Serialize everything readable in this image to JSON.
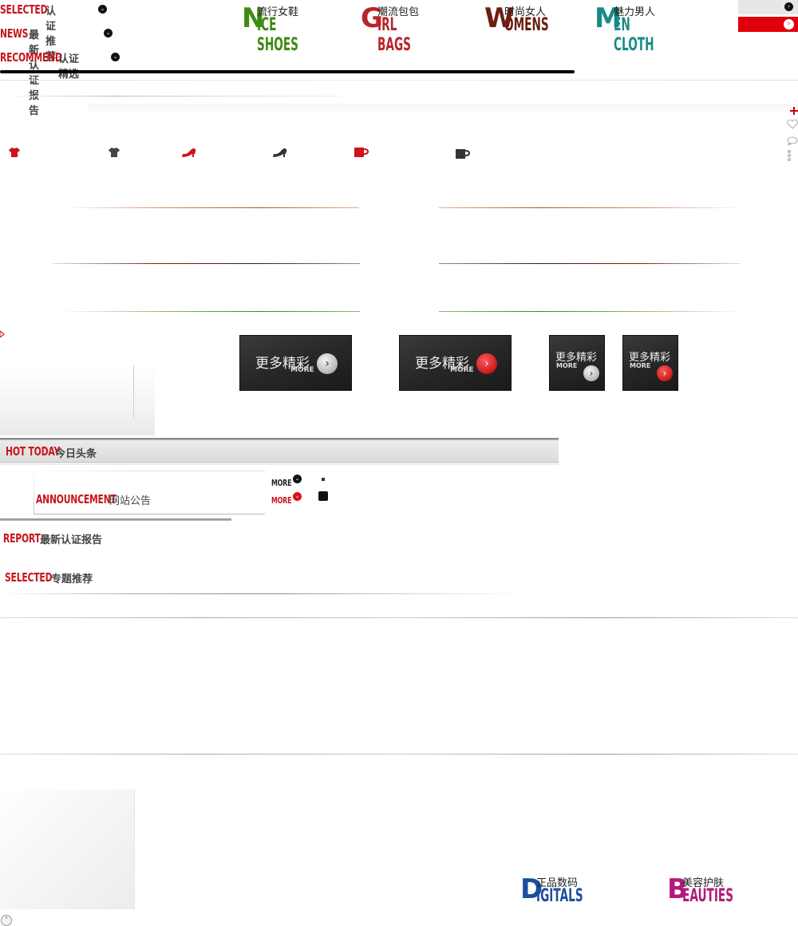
{
  "left_nav": [
    {
      "en": "SELECTED",
      "cn": "认证推荐"
    },
    {
      "en": "NEWS",
      "cn": "最新认证报告"
    },
    {
      "en": "RECOMMEND",
      "cn": "认证精选"
    }
  ],
  "categories": [
    {
      "cn": "流行女鞋",
      "letter": "N",
      "rest": "ICE SHOES",
      "color": "#3d8b12"
    },
    {
      "cn": "潮流包包",
      "letter": "G",
      "rest": "IRL BAGS",
      "color": "#b8242a"
    },
    {
      "cn": "时尚女人",
      "letter": "W",
      "rest": "OMENS",
      "color": "#6b1e10"
    },
    {
      "cn": "魅力男人",
      "letter": "M",
      "rest": "EN CLOTH",
      "color": "#1a8a86"
    }
  ],
  "more_buttons": [
    {
      "cn": "更多精彩",
      "en": "MORE",
      "style": "grey"
    },
    {
      "cn": "更多精彩",
      "en": "MORE",
      "style": "red"
    },
    {
      "cn": "更多精彩",
      "en": "MORE",
      "style": "grey"
    },
    {
      "cn": "更多精彩",
      "en": "MORE",
      "style": "red"
    }
  ],
  "hot_today": {
    "en": "HOT TODAY",
    "cn": "今日头条"
  },
  "announcement": {
    "en": "ANNOUNCEMENT",
    "cn": "网站公告"
  },
  "more_links": [
    {
      "label": "MORE",
      "style": "dark"
    },
    {
      "label": "MORE",
      "style": "red"
    }
  ],
  "report": {
    "en": "REPORT",
    "cn": "最新认证报告"
  },
  "selected2": {
    "en": "SELECTED",
    "cn": "专题推荐"
  },
  "bottom_categories": [
    {
      "cn": "正品数码",
      "letter": "D",
      "rest": "IGITALS",
      "color": "#1d4fa0"
    },
    {
      "cn": "美容护肤",
      "letter": "B",
      "rest": "EAUTIES",
      "color": "#b01a7a"
    }
  ],
  "colors": {
    "accent": "#c8161d",
    "dark": "#111111"
  }
}
